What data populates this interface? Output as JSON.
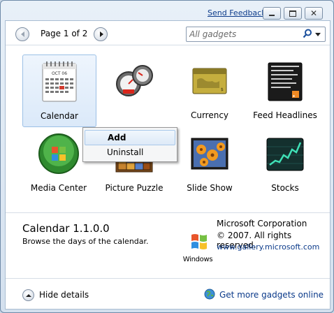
{
  "titlebar": {
    "feedback_label": "Send Feedback",
    "minimize_icon": "minimize-icon",
    "restore_icon": "restore-icon",
    "close_icon": "close-icon"
  },
  "nav": {
    "page_label": "Page 1 of 2",
    "prev_icon": "previous-page-icon",
    "next_icon": "next-page-icon",
    "search_placeholder": "All gadgets"
  },
  "gadgets": [
    {
      "label": "Calendar",
      "icon": "calendar-icon",
      "selected": true
    },
    {
      "label": "",
      "icon": "clock-gauge-icon"
    },
    {
      "label": "Currency",
      "icon": "currency-card-icon"
    },
    {
      "label": "Feed Headlines",
      "icon": "feed-headlines-icon"
    },
    {
      "label": "Media Center",
      "icon": "media-center-icon"
    },
    {
      "label": "Picture Puzzle",
      "icon": "picture-puzzle-icon"
    },
    {
      "label": "Slide Show",
      "icon": "slide-show-icon"
    },
    {
      "label": "Stocks",
      "icon": "stocks-icon"
    }
  ],
  "context_menu": {
    "items": [
      {
        "label": "Add",
        "highlighted": true
      },
      {
        "label": "Uninstall",
        "highlighted": false
      }
    ]
  },
  "details": {
    "name": "Calendar 1.1.0.0",
    "description": "Browse the days of the calendar.",
    "publisher": "Microsoft Corporation",
    "copyright": "© 2007. All rights reserved.",
    "website": "www.gallery.microsoft.com",
    "logo_text": "Windows"
  },
  "footer": {
    "hide_details_label": "Hide details",
    "more_gadgets_label": "Get more gadgets online"
  },
  "calendar_thumb": {
    "month": "OCT 06"
  },
  "colors": {
    "link": "#0b3a8a",
    "selection_border": "#9cc0e6",
    "window_frame": "#c9d7e6"
  }
}
